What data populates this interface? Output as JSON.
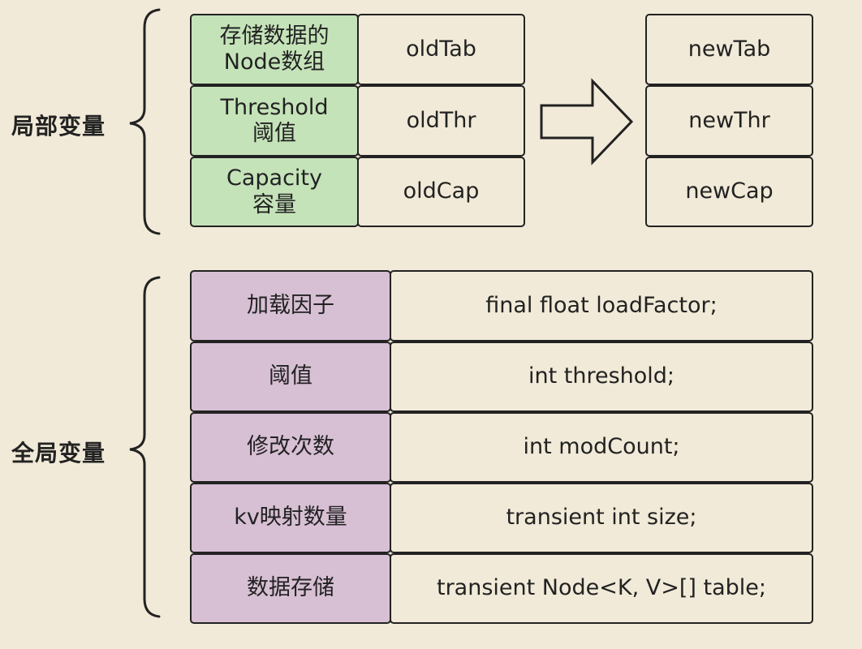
{
  "local_vars": {
    "label": "局部变量",
    "rows": [
      {
        "name_line1": "存储数据的",
        "name_line2": "Node数组",
        "old": "oldTab",
        "new": "newTab"
      },
      {
        "name_line1": "Threshold",
        "name_line2": "阈值",
        "old": "oldThr",
        "new": "newThr"
      },
      {
        "name_line1": "Capacity",
        "name_line2": "容量",
        "old": "oldCap",
        "new": "newCap"
      }
    ]
  },
  "global_vars": {
    "label": "全局变量",
    "rows": [
      {
        "name": "加载因子",
        "code": "final float loadFactor;"
      },
      {
        "name": "阈值",
        "code": "int threshold;"
      },
      {
        "name": "修改次数",
        "code": "int modCount;"
      },
      {
        "name": "kv映射数量",
        "code": "transient int size;"
      },
      {
        "name": "数据存储",
        "code": "transient Node<K, V>[] table;"
      }
    ]
  },
  "colors": {
    "background": "#f1ead8",
    "local_name_fill": "#c5e3b9",
    "global_name_fill": "#d7bfd4",
    "border": "#222222"
  },
  "icons": [
    "left-brace-icon",
    "right-arrow-icon"
  ]
}
